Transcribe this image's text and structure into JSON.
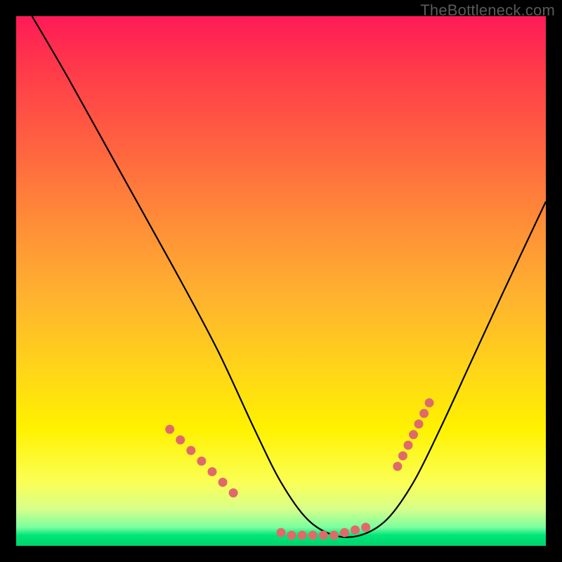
{
  "watermark": "TheBottleneck.com",
  "chart_data": {
    "type": "line",
    "title": "",
    "xlabel": "",
    "ylabel": "",
    "xlim": [
      0,
      100
    ],
    "ylim": [
      0,
      100
    ],
    "series": [
      {
        "name": "bottleneck-curve",
        "x": [
          3,
          10,
          20,
          30,
          38,
          45,
          50,
          55,
          60,
          65,
          70,
          75,
          80,
          86,
          92,
          100
        ],
        "y": [
          100,
          88,
          70,
          52,
          37,
          22,
          12,
          5,
          2,
          2,
          5,
          12,
          22,
          35,
          48,
          65
        ]
      }
    ],
    "markers": {
      "name": "highlight-dots",
      "color": "#e06a6a",
      "x": [
        29,
        31,
        33,
        35,
        37,
        39,
        41,
        50,
        52,
        54,
        56,
        58,
        60,
        62,
        64,
        66,
        72,
        73,
        74,
        75,
        76,
        77,
        78
      ],
      "y": [
        22,
        20,
        18,
        16,
        14,
        12,
        10,
        2.5,
        2,
        2,
        2,
        2,
        2,
        2.5,
        3,
        3.5,
        15,
        17,
        19,
        21,
        23,
        25,
        27
      ]
    }
  }
}
